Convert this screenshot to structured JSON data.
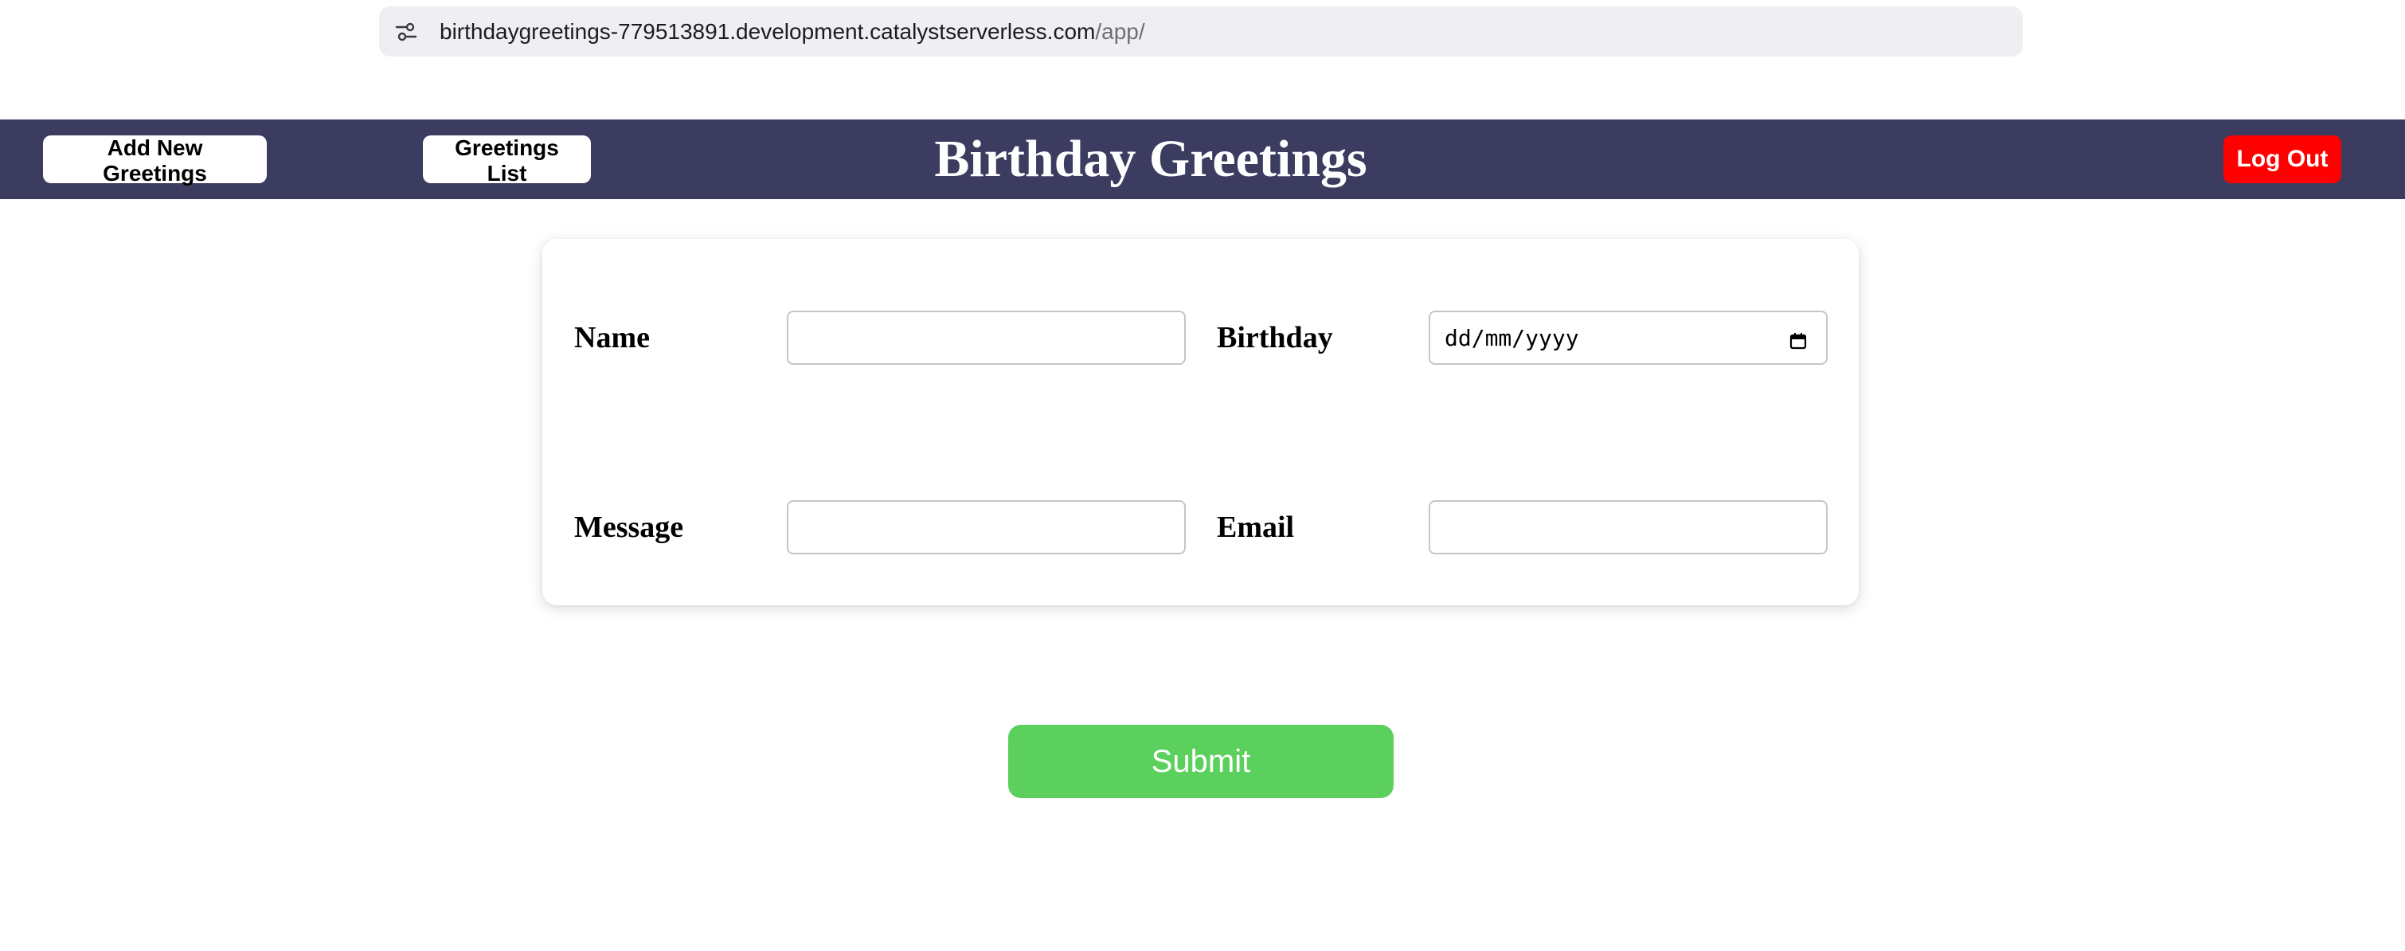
{
  "browser": {
    "url_host": "birthdaygreetings-779513891.development.catalystserverless.com",
    "url_path": "/app/",
    "site_settings_icon": "site-settings-icon"
  },
  "header": {
    "add_new_label": "Add New Greetings",
    "list_label": "Greetings List",
    "title": "Birthday Greetings",
    "logout_label": "Log Out",
    "background_color": "#3b3c60",
    "logout_color": "#ff0000"
  },
  "form": {
    "name_label": "Name",
    "name_value": "",
    "birthday_label": "Birthday",
    "birthday_placeholder": "dd/mm/yyyy",
    "birthday_icon": "calendar-icon",
    "message_label": "Message",
    "message_value": "",
    "email_label": "Email",
    "email_value": "",
    "submit_label": "Submit",
    "submit_color": "#5cd05c"
  }
}
